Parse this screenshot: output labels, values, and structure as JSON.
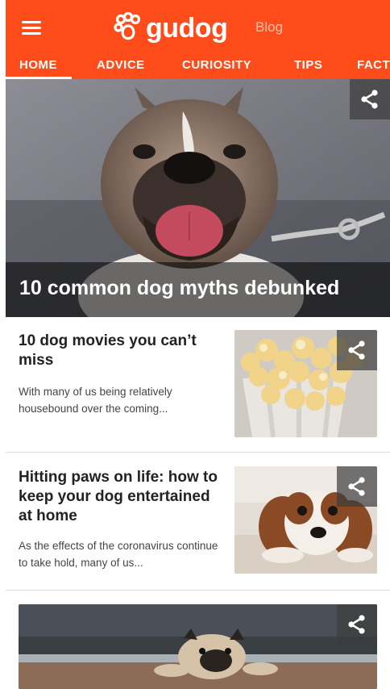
{
  "header": {
    "brand": "gudog",
    "sub": "Blog",
    "colors": {
      "accent": "#ff4c1a"
    }
  },
  "tabs": [
    {
      "label": "HOME",
      "active": true
    },
    {
      "label": "ADVICE",
      "active": false
    },
    {
      "label": "CURIOSITY",
      "active": false
    },
    {
      "label": "TIPS",
      "active": false
    },
    {
      "label": "FACT",
      "active": false
    }
  ],
  "hero": {
    "title": "10 common dog myths debunked",
    "image": "french-bulldog-tongue-out",
    "share_icon": "share-icon"
  },
  "articles": [
    {
      "title": "10 dog movies you can’t miss",
      "excerpt": "With many of us being relatively housebound over the coming...",
      "image": "popcorn-box"
    },
    {
      "title": "Hitting paws on life: how to keep your dog entertained at home",
      "excerpt": "As the effects of the coronavirus continue to take hold, many of us...",
      "image": "cavalier-spaniel-on-rug"
    },
    {
      "title": "",
      "excerpt": "",
      "image": "pug-lying-on-floor"
    }
  ]
}
